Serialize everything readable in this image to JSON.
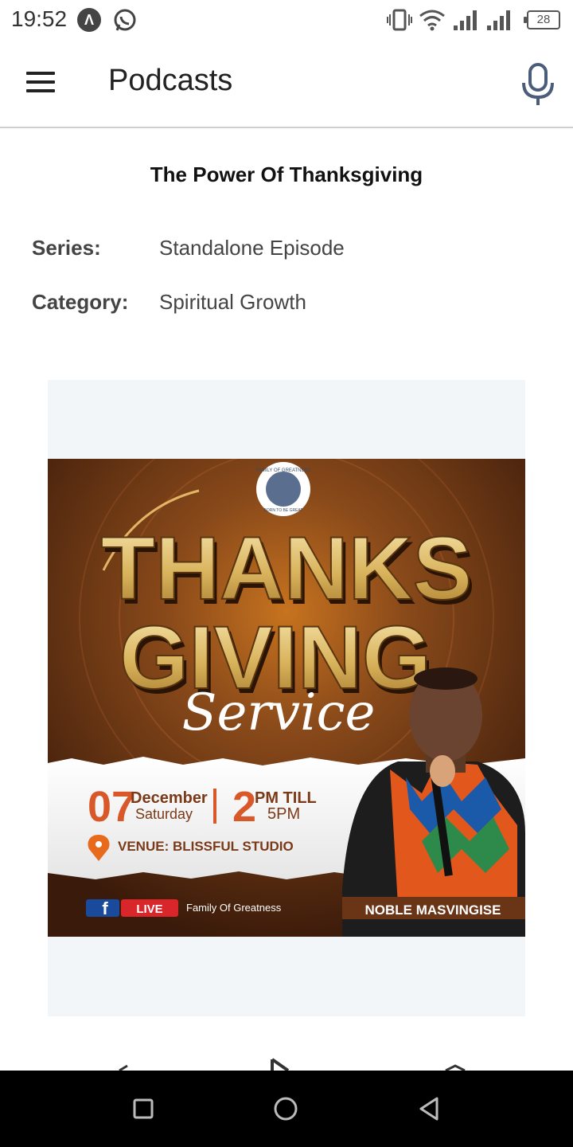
{
  "status_bar": {
    "time": "19:52",
    "battery": "28",
    "icons": [
      "a-badge-icon",
      "whatsapp-icon",
      "vibrate-icon",
      "wifi-icon",
      "signal-icon",
      "signal-icon",
      "battery-icon"
    ]
  },
  "app_bar": {
    "title": "Podcasts",
    "menu_icon": "hamburger-menu-icon",
    "action_icon": "microphone-icon"
  },
  "episode": {
    "title": "The Power Of Thanksgiving",
    "series_label": "Series:",
    "series_value": "Standalone Episode",
    "category_label": "Category:",
    "category_value": "Spiritual Growth"
  },
  "poster": {
    "headline_line1": "THANKS",
    "headline_line2": "GIVING",
    "script_word": "Service",
    "logo_text_top": "FAMILY OF GREATNESS",
    "logo_text_bottom": "BORN TO BE GREAT",
    "day": "07",
    "month": "December",
    "weekday": "Saturday",
    "time_hour": "2",
    "time_text1": "PM TILL",
    "time_text2": "5PM",
    "venue": "VENUE: BLISSFUL STUDIO",
    "live_badge": "LIVE",
    "fb_letter": "f",
    "page_name": "Family Of Greatness",
    "speaker": "NOBLE MASVINGISE",
    "colors": {
      "bg": "#5a2e12",
      "gold": "#e8c97a",
      "accent": "#e86a1c",
      "red": "#d8262a",
      "fb_blue": "#1a4a9c"
    }
  },
  "nav_bar": {
    "icons": [
      "recent-apps-icon",
      "home-icon",
      "back-icon"
    ]
  }
}
